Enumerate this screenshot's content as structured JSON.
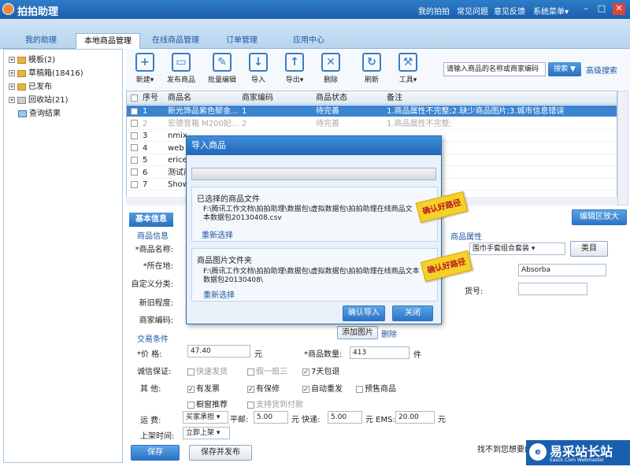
{
  "app": {
    "title": "拍拍助理",
    "links": [
      "我的拍拍",
      "常见问题",
      "意见反馈",
      "系统菜单▾"
    ],
    "win": [
      "–",
      "□",
      "✕"
    ]
  },
  "tabs": [
    "我的助理",
    "本地商品管理",
    "在线商品管理",
    "订单管理",
    "应用中心"
  ],
  "tree": [
    "模板(2)",
    "草稿箱(18416)",
    "已发布",
    "回收站(21)",
    "查询结果"
  ],
  "tools": [
    {
      "l": "新建▾",
      "i": "+"
    },
    {
      "l": "发布商品",
      "i": "▭"
    },
    {
      "l": "批量编辑",
      "i": "✎"
    },
    {
      "l": "导入",
      "i": "↓"
    },
    {
      "l": "导出▾",
      "i": "↑"
    },
    {
      "l": "删除",
      "i": "✕"
    },
    {
      "l": "刷新",
      "i": "↻"
    },
    {
      "l": "工具▾",
      "i": "⚒"
    }
  ],
  "search": {
    "placeholder": "请输入商品的名称或商家编码",
    "btn": "搜索 ▼",
    "adv": "高级搜索"
  },
  "grid": {
    "headers": [
      "序号",
      "商品名",
      "商家编码",
      "商品状态",
      "备注"
    ],
    "rows": [
      [
        "1",
        "新光饰品紫色郁金...",
        "1",
        "待完善",
        "1.商品属性不完整;2.缺少商品图片;3.城市信息错误"
      ],
      [
        "2",
        "宏德音箱 M200妃...",
        "2",
        "待完善",
        "1.商品属性不完整;"
      ],
      [
        "3",
        "nmix",
        "",
        "",
        ""
      ],
      [
        "4",
        "web",
        "",
        "",
        ""
      ],
      [
        "5",
        "erice",
        "",
        "",
        ""
      ],
      [
        "6",
        "测试商",
        "",
        "",
        ""
      ],
      [
        "7",
        "Show",
        "",
        "",
        ""
      ]
    ]
  },
  "edit": {
    "tab": "基本信息",
    "zone": "编辑区放大",
    "goods": "商品信息",
    "name": "*商品名称:",
    "loc": "*所在地:",
    "cat": "自定义分类:",
    "newold": "新旧程度:",
    "code": "商家编码:",
    "trade": "交易条件",
    "price_l": "*价    格:",
    "price": "47.40",
    "unit": "元",
    "qty_l": "*商品数量:",
    "qty": "413",
    "piece": "件",
    "guar": "诚信保证:",
    "g1": "快速发货",
    "g2": "假一赔三",
    "g3": "7天包退",
    "other": "其    他:",
    "o1": "有发票",
    "o2": "有保修",
    "o3": "自动重发",
    "o4": "预售商品",
    "o5": "橱窗推荐",
    "o6": "支持货到付款",
    "freight": "运    费:",
    "bearer": "买家承担",
    "p1": "平邮:",
    "p1v": "5.00",
    "p2": "元 快递:",
    "p2v": "5.00",
    "p3": "元 EMS:",
    "p3v": "20.00",
    "p4": "元",
    "time": "上架时间:",
    "timev": "立即上架",
    "save": "保存(Ctrl+S)",
    "savepub": "保存并发布",
    "addpic": "添加图片",
    "delpic": "删除"
  },
  "attrs": {
    "title": "商品属性",
    "set": "围巾手套组合套装",
    "cat": "类目",
    "brandv": "Absorba",
    "no": "货号:",
    "notfound": "找不到您想要的"
  },
  "dialog": {
    "title": "导入商品",
    "f1": "已选择的商品文件",
    "p1": "F:\\腾讯工作文档\\拍拍助理\\数据包\\虚拟数据包\\拍拍助理在线商品文本数据包20130408.csv",
    "r1": "重新选择",
    "f2": "商品图片文件夹",
    "p2": "F:\\腾讯工作文档\\拍拍助理\\数据包\\虚拟数据包\\拍拍助理在线商品文本数据包20130408\\",
    "r2": "重新选择",
    "ok": "确认导入",
    "close": "关闭",
    "s1": "确认好路径",
    "s2": "确认好路径"
  },
  "watermark": {
    "text": "易采站长站",
    "sub": "Easck.Com Webmaster",
    "ico": "e"
  }
}
